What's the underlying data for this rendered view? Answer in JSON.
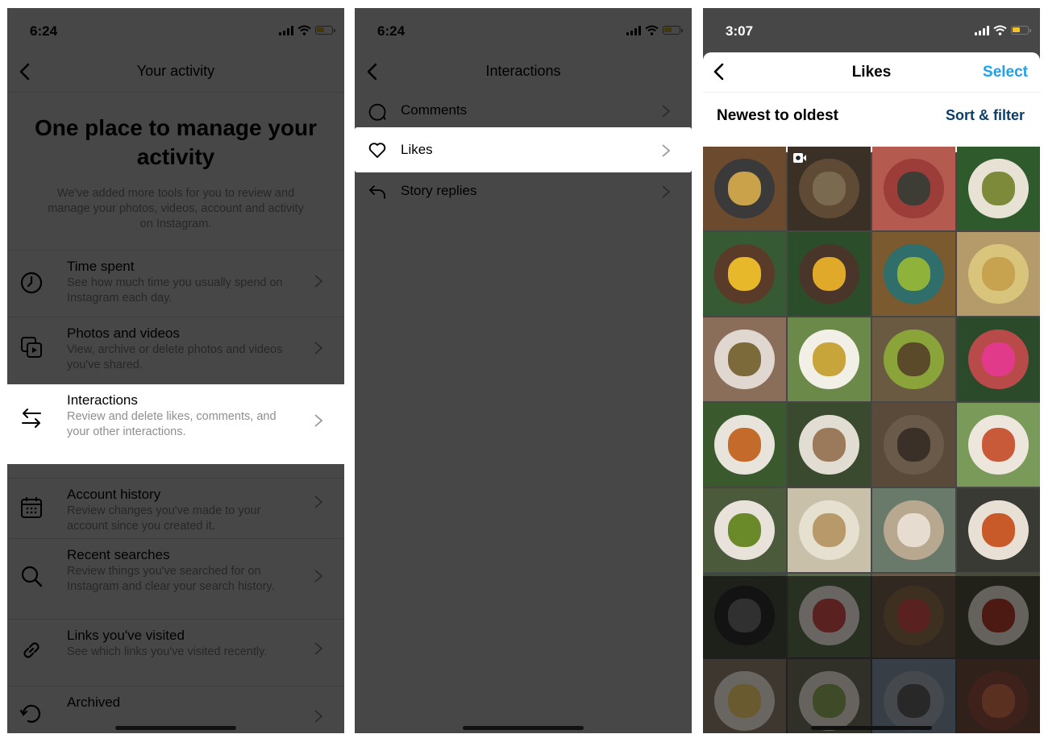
{
  "colors": {
    "accent_blue": "#1da1f2",
    "sort_blue": "#0d3d6b",
    "battery_yellow": "#f2c230",
    "overlay": "rgba(0,0,0,0.72)"
  },
  "panel1": {
    "status_time": "6:24",
    "nav_title": "Your activity",
    "hero_title": "One place to manage your activity",
    "hero_desc": "We've added more tools for you to review and manage your photos, videos, account and activity on Instagram.",
    "items": [
      {
        "title": "Time spent",
        "desc": "See how much time you usually spend on Instagram each day.",
        "icon": "clock-icon"
      },
      {
        "title": "Photos and videos",
        "desc": "View, archive or delete photos and videos you've shared.",
        "icon": "photos-videos-icon"
      },
      {
        "title": "Interactions",
        "desc": "Review and delete likes, comments, and your other interactions.",
        "icon": "interactions-arrows-icon",
        "highlighted": true
      },
      {
        "title": "Account history",
        "desc": "Review changes you've made to your account since you created it.",
        "icon": "calendar-icon"
      },
      {
        "title": "Recent searches",
        "desc": "Review things you've searched for on Instagram and clear your search history.",
        "icon": "search-icon"
      },
      {
        "title": "Links you've visited",
        "desc": "See which links you've visited recently.",
        "icon": "link-icon"
      },
      {
        "title": "Archived",
        "desc": "",
        "icon": "archive-icon"
      }
    ]
  },
  "panel2": {
    "status_time": "6:24",
    "nav_title": "Interactions",
    "items": [
      {
        "label": "Comments",
        "icon": "comment-icon"
      },
      {
        "label": "Likes",
        "icon": "heart-icon",
        "highlighted": true
      },
      {
        "label": "Story replies",
        "icon": "reply-icon"
      }
    ]
  },
  "panel3": {
    "status_time": "3:07",
    "nav_title": "Likes",
    "select_label": "Select",
    "sort_label": "Newest to oldest",
    "sort_filter_label": "Sort & filter",
    "tiles": [
      {
        "bg": "#6b4a2e",
        "plate": "#3a3a3a",
        "food": "#c9a24a",
        "reel": false
      },
      {
        "bg": "#3b3026",
        "plate": "#5e4a35",
        "food": "#7a6a50",
        "reel": true
      },
      {
        "bg": "#b45a4e",
        "plate": "#9c3d3a",
        "food": "#3d3d35",
        "reel": false
      },
      {
        "bg": "#2f5a2c",
        "plate": "#e8e2d5",
        "food": "#7c8a3a",
        "reel": false
      },
      {
        "bg": "#355a34",
        "plate": "#5a3b2a",
        "food": "#e6b82a",
        "reel": false
      },
      {
        "bg": "#2c4d2a",
        "plate": "#4a352a",
        "food": "#e0a92a",
        "reel": false
      },
      {
        "bg": "#7a5a2e",
        "plate": "#2f6e6a",
        "food": "#8fb33a",
        "reel": false
      },
      {
        "bg": "#b59a6a",
        "plate": "#d8c47a",
        "food": "#c7a24f",
        "reel": false
      },
      {
        "bg": "#8a6e5a",
        "plate": "#e0d8d0",
        "food": "#7d6a3a",
        "reel": false
      },
      {
        "bg": "#6b8a4a",
        "plate": "#f2efe6",
        "food": "#c8a53a",
        "reel": false
      },
      {
        "bg": "#6a5a42",
        "plate": "#8aa43a",
        "food": "#5a4a2a",
        "reel": false
      },
      {
        "bg": "#2a4a2a",
        "plate": "#b84a4a",
        "food": "#e23a8a",
        "reel": false
      },
      {
        "bg": "#3a5a2e",
        "plate": "#e8e4dc",
        "food": "#c46a2a",
        "reel": false
      },
      {
        "bg": "#3a4a2e",
        "plate": "#e2ddd2",
        "food": "#9a7a5a",
        "reel": false
      },
      {
        "bg": "#5a4a3a",
        "plate": "#6a5a4a",
        "food": "#3a3028",
        "reel": false
      },
      {
        "bg": "#7a9a5a",
        "plate": "#ece6dc",
        "food": "#c85a3a",
        "reel": false
      },
      {
        "bg": "#4a5a3a",
        "plate": "#e8e2da",
        "food": "#6a8a2a",
        "reel": false
      },
      {
        "bg": "#c8c0a8",
        "plate": "#e6e0d0",
        "food": "#b89a6a",
        "reel": false
      },
      {
        "bg": "#6a7a6a",
        "plate": "#b8a890",
        "food": "#e6dcd0",
        "reel": false
      },
      {
        "bg": "#3a3a35",
        "plate": "#e8e0d4",
        "food": "#c85a2a",
        "reel": false
      },
      {
        "bg": "#404a3a",
        "plate": "#2a2a2a",
        "food": "#6a6a6a",
        "reel": false
      },
      {
        "bg": "#5a6a4a",
        "plate": "#e6e0da",
        "food": "#c84a4a",
        "reel": false
      },
      {
        "bg": "#6a5a4a",
        "plate": "#8a6a4a",
        "food": "#c84a4a",
        "reel": false
      },
      {
        "bg": "#4a4a3a",
        "plate": "#e0d8cc",
        "food": "#a83a2a",
        "reel": false
      },
      {
        "bg": "#8a7a6a",
        "plate": "#e8e2da",
        "food": "#e8c86a",
        "reel": false
      },
      {
        "bg": "#6a6a5a",
        "plate": "#e2dcd2",
        "food": "#8aa45a",
        "reel": false
      },
      {
        "bg": "#7a8a9a",
        "plate": "#9aa0a8",
        "food": "#5a5a5a",
        "reel": false
      },
      {
        "bg": "#6a4a3a",
        "plate": "#8a4a3a",
        "food": "#c86a4a",
        "reel": false
      }
    ]
  }
}
